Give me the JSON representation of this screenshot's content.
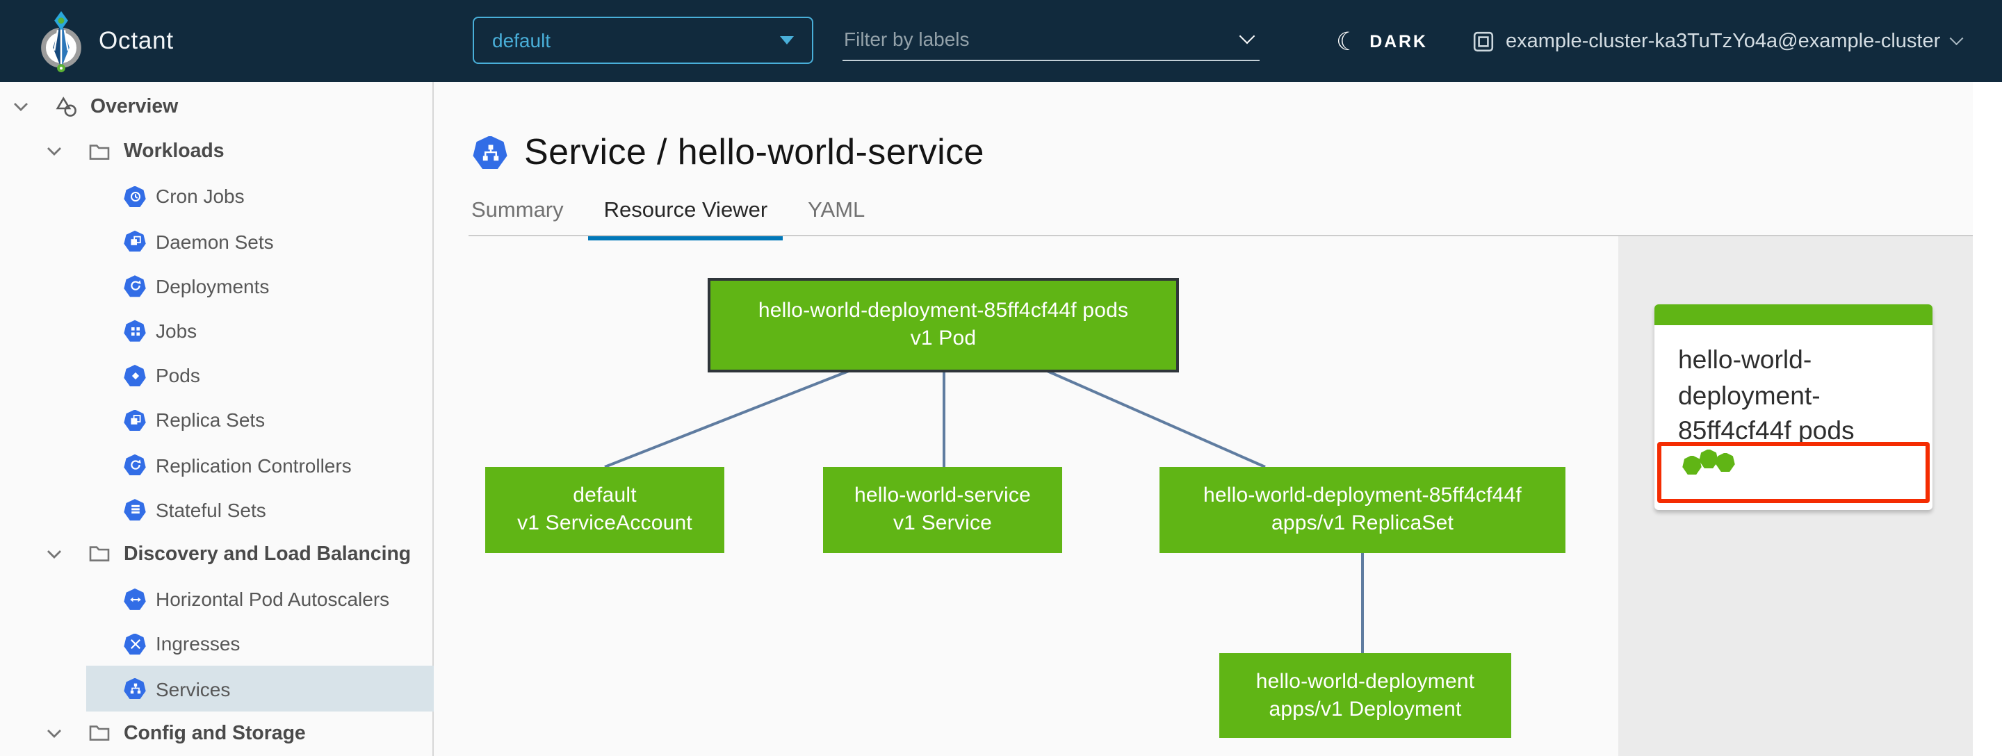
{
  "header": {
    "app_title": "Octant",
    "namespace_dropdown": {
      "value": "default"
    },
    "filter_input": {
      "placeholder": "Filter by labels"
    },
    "theme_toggle_label": "DARK",
    "cluster_context": "example-cluster-ka3TuTzYo4a@example-cluster"
  },
  "sidebar": {
    "items": [
      {
        "label": "Overview",
        "level": 0,
        "expanded": true
      },
      {
        "label": "Workloads",
        "level": 1,
        "expanded": true
      },
      {
        "label": "Cron Jobs",
        "level": 2
      },
      {
        "label": "Daemon Sets",
        "level": 2
      },
      {
        "label": "Deployments",
        "level": 2
      },
      {
        "label": "Jobs",
        "level": 2
      },
      {
        "label": "Pods",
        "level": 2
      },
      {
        "label": "Replica Sets",
        "level": 2
      },
      {
        "label": "Replication Controllers",
        "level": 2
      },
      {
        "label": "Stateful Sets",
        "level": 2
      },
      {
        "label": "Discovery and Load Balancing",
        "level": 1,
        "expanded": true
      },
      {
        "label": "Horizontal Pod Autoscalers",
        "level": 2
      },
      {
        "label": "Ingresses",
        "level": 2
      },
      {
        "label": "Services",
        "level": 2,
        "selected": true
      },
      {
        "label": "Config and Storage",
        "level": 1,
        "expanded": true
      }
    ]
  },
  "main": {
    "page_title": "Service / hello-world-service",
    "tabs": [
      {
        "label": "Summary",
        "active": false
      },
      {
        "label": "Resource Viewer",
        "active": true
      },
      {
        "label": "YAML",
        "active": false
      }
    ]
  },
  "graph": {
    "nodes": [
      {
        "name": "hello-world-deployment-85ff4cf44f pods",
        "kind": "v1 Pod",
        "status": "ok",
        "selected": true
      },
      {
        "name": "default",
        "kind": "v1 ServiceAccount",
        "status": "ok"
      },
      {
        "name": "hello-world-service",
        "kind": "v1 Service",
        "status": "ok"
      },
      {
        "name": "hello-world-deployment-85ff4cf44f",
        "kind": "apps/v1 ReplicaSet",
        "status": "ok"
      },
      {
        "name": "hello-world-deployment",
        "kind": "apps/v1 Deployment",
        "status": "ok"
      }
    ]
  },
  "detail_panel": {
    "card_title": "hello-world-deployment-85ff4cf44f pods",
    "pod_status": {
      "ok_count": 3
    }
  },
  "colors": {
    "header_bg": "#112a3d",
    "accent_blue": "#49afd9",
    "node_green": "#60b515",
    "edge_blue": "#5f7ca0",
    "selection_red": "#f42c02",
    "active_tab_underline": "#0077b8",
    "panel_bg": "#ebebeb",
    "sidebar_selected_bg": "#d8e3e9",
    "k8s_icon_blue": "#326de6"
  }
}
